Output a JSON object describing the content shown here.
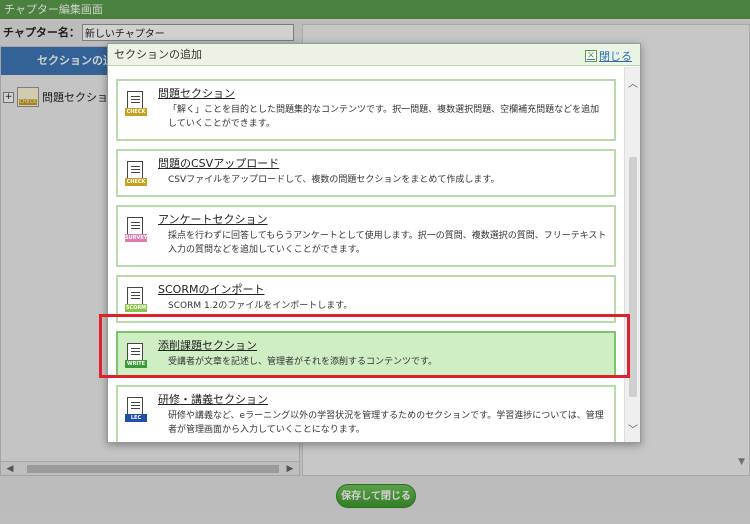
{
  "window": {
    "title": "チャプター編集画面"
  },
  "chapter": {
    "name_label": "チャプター名：",
    "name_value": "新しいチャプター"
  },
  "sidebar": {
    "add_section_label": "セクションの追加",
    "tree_item_label": "問題セクション",
    "tree_item_icon": "check-icon"
  },
  "modal": {
    "title": "セクションの追加",
    "close_label": "閉じる",
    "items": [
      {
        "title": "問題セクション",
        "description": "「解く」ことを目的とした問題集的なコンテンツです。択一問題、複数選択問題、空欄補充問題などを追加していくことができます。",
        "icon": "check-icon",
        "tag": "CHECK",
        "tag_color": "#c8a020"
      },
      {
        "title": "問題のCSVアップロード",
        "description": "CSVファイルをアップロードして、複数の問題セクションをまとめて作成します。",
        "icon": "csv-check-icon",
        "tag": "CHECK",
        "tag_color": "#c8a020"
      },
      {
        "title": "アンケートセクション",
        "description": "採点を行わずに回答してもらうアンケートとして使用します。択一の質問、複数選択の質問、フリーテキスト入力の質問などを追加していくことができます。",
        "icon": "survey-icon",
        "tag": "SURVEY",
        "tag_color": "#e07ab0"
      },
      {
        "title": "SCORMのインポート",
        "description": "SCORM 1.2のファイルをインポートします。",
        "icon": "scorm-icon",
        "tag": "SCORM",
        "tag_color": "#8bc34a"
      },
      {
        "title": "添削課題セクション",
        "description": "受講者が文章を記述し、管理者がそれを添削するコンテンツです。",
        "icon": "write-icon",
        "tag": "WRITE",
        "tag_color": "#3a9a3a"
      },
      {
        "title": "研修・講義セクション",
        "description": "研修や講義など、eラーニング以外の学習状況を管理するためのセクションです。学習進捗については、管理者が管理画面から入力していくことになります。",
        "icon": "lecture-icon",
        "tag": "LEC",
        "tag_color": "#1f4fa8"
      }
    ]
  },
  "footer": {
    "save_close_label": "保存して閉じる"
  },
  "colors": {
    "header_green": "#5c9e4d",
    "accent_blue": "#3f79b8",
    "highlight_red": "#e0202a"
  }
}
